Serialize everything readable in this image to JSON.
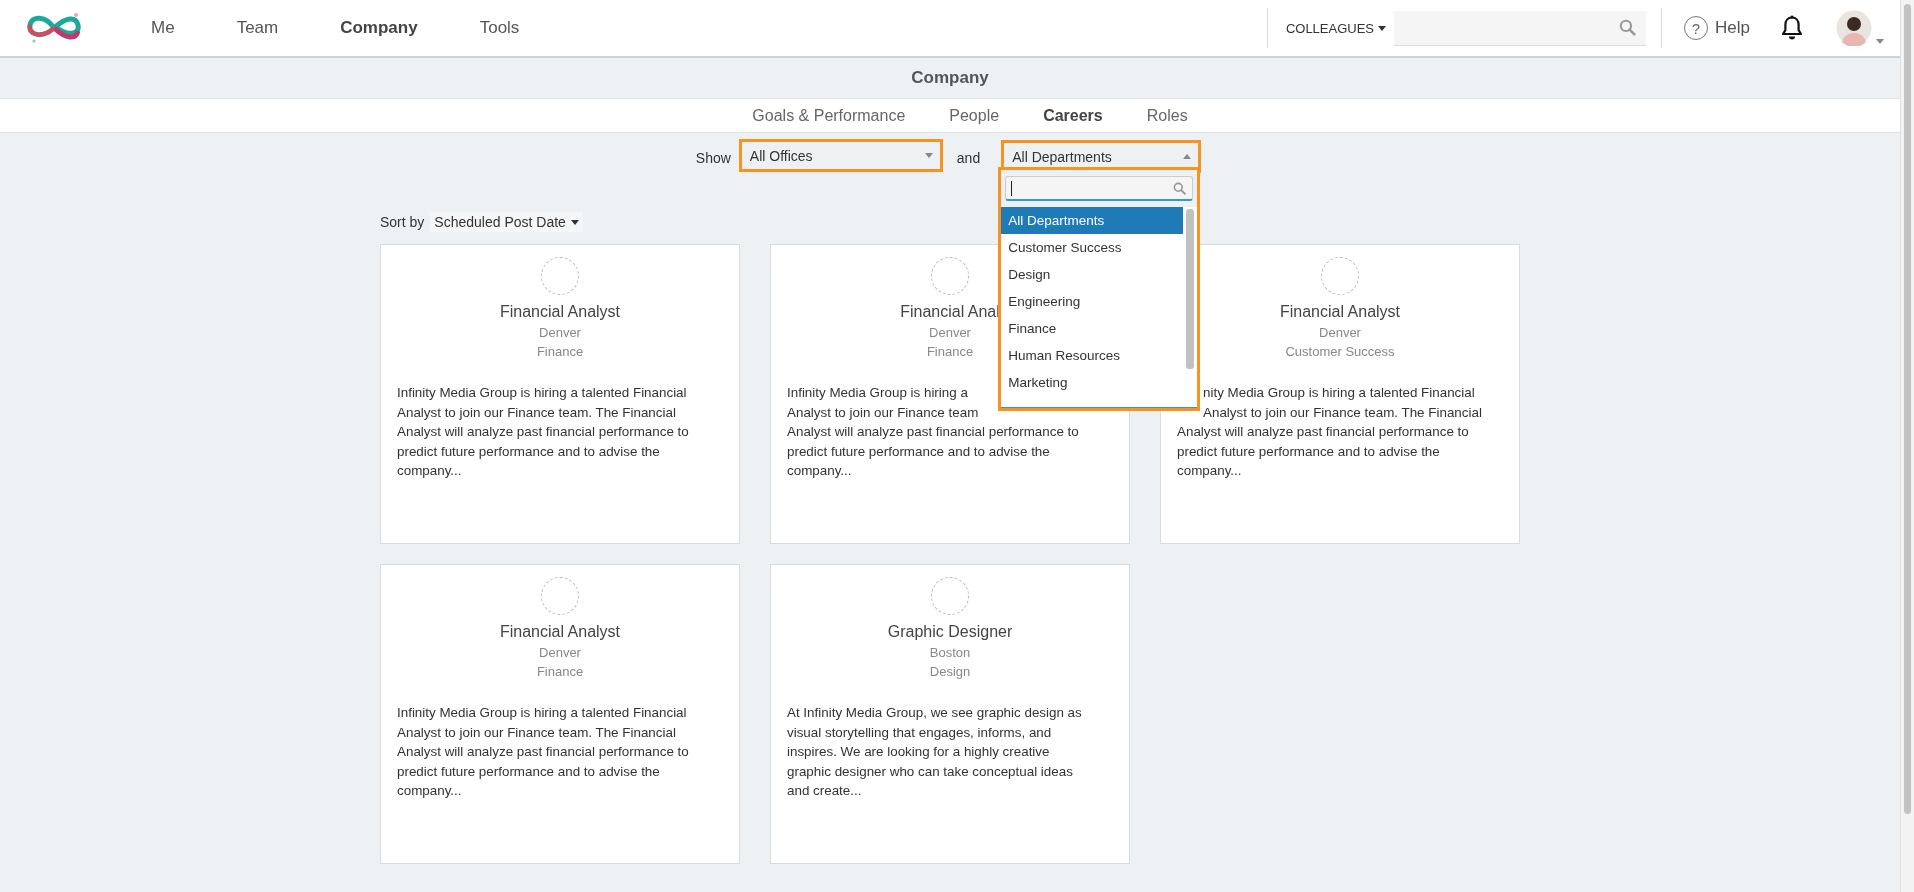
{
  "nav": {
    "items": [
      {
        "label": "Me",
        "selected": false
      },
      {
        "label": "Team",
        "selected": false
      },
      {
        "label": "Company",
        "selected": true
      },
      {
        "label": "Tools",
        "selected": false
      }
    ],
    "colleagues_menu": "COLLEAGUES",
    "help": {
      "glyph": "?",
      "label": "Help"
    }
  },
  "page_title": "Company",
  "subnav": [
    {
      "label": "Goals & Performance",
      "selected": false
    },
    {
      "label": "People",
      "selected": false
    },
    {
      "label": "Careers",
      "selected": true
    },
    {
      "label": "Roles",
      "selected": false
    }
  ],
  "filters": {
    "show_label": "Show",
    "office": {
      "value": "All Offices",
      "highlighted": true,
      "expanded": false
    },
    "joiner": "and",
    "department": {
      "value": "All Departments",
      "highlighted": true,
      "expanded": true,
      "options": [
        {
          "label": "All Departments",
          "selected": true
        },
        {
          "label": "Customer Success",
          "selected": false
        },
        {
          "label": "Design",
          "selected": false
        },
        {
          "label": "Engineering",
          "selected": false
        },
        {
          "label": "Finance",
          "selected": false
        },
        {
          "label": "Human Resources",
          "selected": false
        },
        {
          "label": "Marketing",
          "selected": false
        }
      ]
    }
  },
  "sort": {
    "label": "Sort by",
    "value": "Scheduled Post Date"
  },
  "cards": [
    {
      "title": "Financial Analyst",
      "location": "Denver",
      "department": "Finance",
      "description_lines": [
        "Infinity Media Group is hiring a talented Financial",
        "Analyst to join our Finance team. The Financial",
        "Analyst will analyze past financial performance to",
        "predict future performance and to advise the",
        "company..."
      ]
    },
    {
      "title": "Financial Anal",
      "location": "Denver",
      "department": "Finance",
      "description_lines": [
        "Infinity Media Group is hiring a",
        "Analyst to join our Finance team",
        "Analyst will analyze past financial performance to",
        "predict future performance and to advise the",
        "company..."
      ]
    },
    {
      "title": "Financial Analyst",
      "location": "Denver",
      "department": "Customer Success",
      "description_lines": [
        "nity Media Group is hiring a talented Financial",
        "Analyst to join our Finance team. The Financial",
        "Analyst will analyze past financial performance to",
        "predict future performance and to advise the",
        "company..."
      ]
    },
    {
      "title": "Financial Analyst",
      "location": "Denver",
      "department": "Finance",
      "description_lines": [
        "Infinity Media Group is hiring a talented Financial",
        "Analyst to join our Finance team. The Financial",
        "Analyst will analyze past financial performance to",
        "predict future performance and to advise the",
        "company..."
      ]
    },
    {
      "title": "Graphic Designer",
      "location": "Boston",
      "department": "Design",
      "description_lines": [
        "At Infinity Media Group, we see graphic design as",
        "visual storytelling that engages, informs, and",
        "inspires. We are looking for a highly creative",
        "graphic designer who can take conceptual ideas",
        "and create..."
      ]
    }
  ]
}
